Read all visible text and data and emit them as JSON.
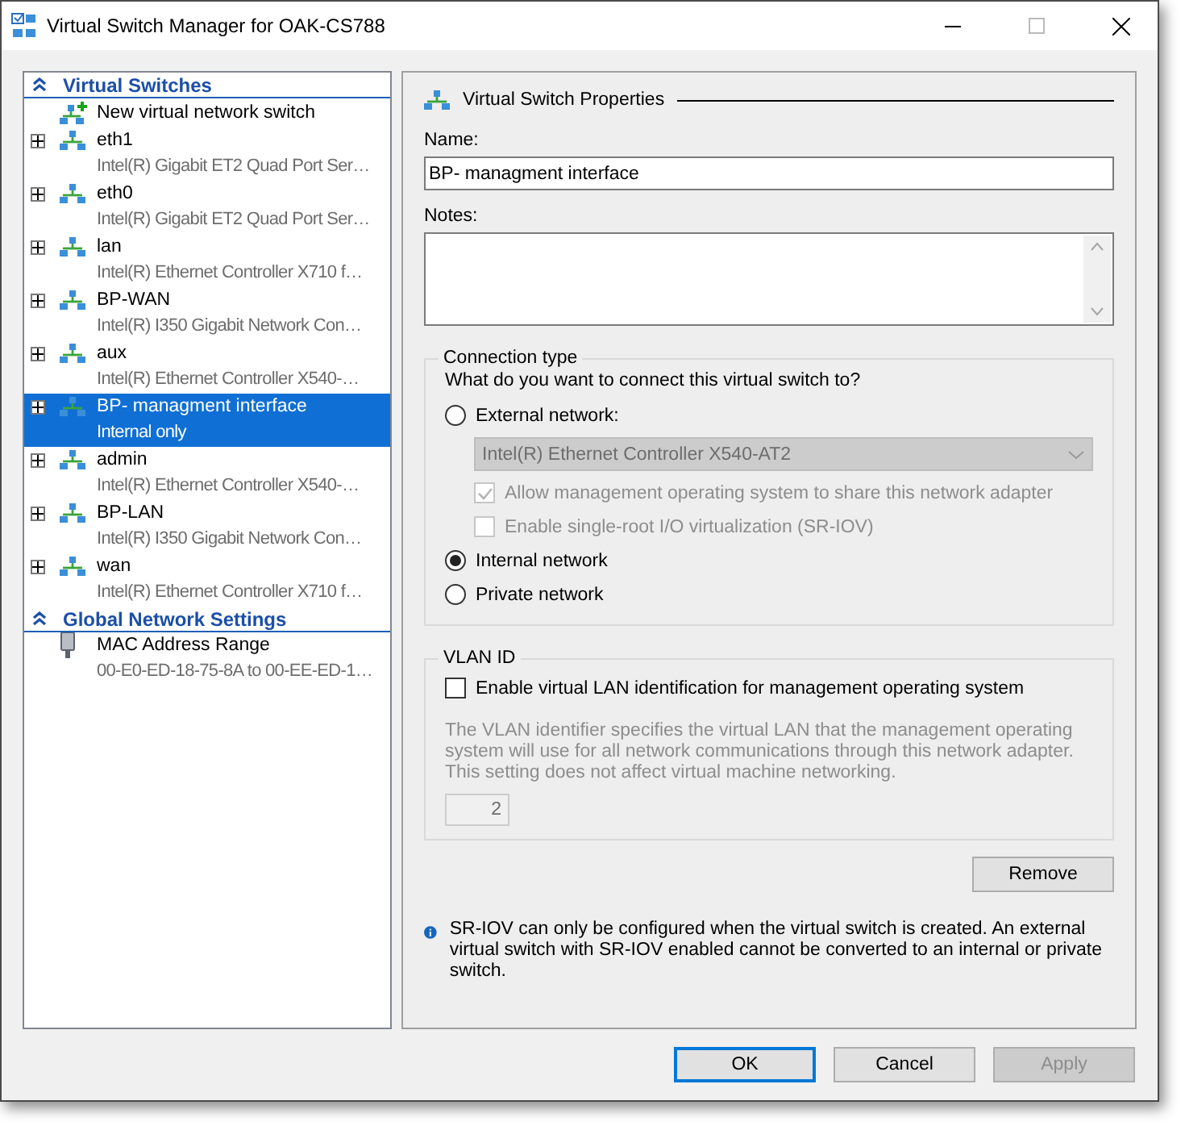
{
  "window": {
    "title": "Virtual Switch Manager for OAK-CS788"
  },
  "sidebar": {
    "sections": [
      {
        "title": "Virtual Switches",
        "expanded": true,
        "items": [
          {
            "kind": "new",
            "name": "New virtual network switch",
            "selected": false
          },
          {
            "kind": "switch",
            "name": "eth1",
            "detail": "Intel(R) Gigabit ET2 Quad Port Ser…",
            "selected": false
          },
          {
            "kind": "switch",
            "name": "eth0",
            "detail": "Intel(R) Gigabit ET2 Quad Port Ser…",
            "selected": false
          },
          {
            "kind": "switch",
            "name": "lan",
            "detail": "Intel(R) Ethernet Controller X710 f…",
            "selected": false
          },
          {
            "kind": "switch",
            "name": "BP-WAN",
            "detail": "Intel(R) I350 Gigabit Network Con…",
            "selected": false
          },
          {
            "kind": "switch",
            "name": "aux",
            "detail": "Intel(R) Ethernet Controller X540-…",
            "selected": false
          },
          {
            "kind": "switch",
            "name": "BP- managment interface",
            "detail": "Internal only",
            "selected": true
          },
          {
            "kind": "switch",
            "name": "admin",
            "detail": "Intel(R) Ethernet Controller X540-…",
            "selected": false
          },
          {
            "kind": "switch",
            "name": "BP-LAN",
            "detail": "Intel(R) I350 Gigabit Network Con…",
            "selected": false
          },
          {
            "kind": "switch",
            "name": "wan",
            "detail": "Intel(R) Ethernet Controller X710 f…",
            "selected": false
          }
        ]
      },
      {
        "title": "Global Network Settings",
        "expanded": true,
        "items": [
          {
            "kind": "setting",
            "name": "MAC Address Range",
            "detail": "00-E0-ED-18-75-8A to 00-EE-ED-1…",
            "selected": false
          }
        ]
      }
    ]
  },
  "properties": {
    "heading": "Virtual Switch Properties",
    "name_label": "Name:",
    "name_value": "BP- managment interface",
    "notes_label": "Notes:",
    "connection": {
      "legend": "Connection type",
      "question": "What do you want to connect this virtual switch to?",
      "options": [
        {
          "label": "External network:",
          "selected": false,
          "adapter": {
            "value": "Intel(R) Ethernet Controller X540-AT2",
            "disabled": true
          },
          "checkboxes": [
            {
              "label": "Allow management operating system to share this network adapter",
              "checked": true,
              "disabled": true
            },
            {
              "label": "Enable single-root I/O virtualization (SR-IOV)",
              "checked": false,
              "disabled": true
            }
          ]
        },
        {
          "label": "Internal network",
          "selected": true
        },
        {
          "label": "Private network",
          "selected": false
        }
      ]
    },
    "vlan": {
      "legend": "VLAN ID",
      "checkbox": {
        "label": "Enable virtual LAN identification for management operating system",
        "checked": false
      },
      "description": "The VLAN identifier specifies the virtual LAN that the management operating system will use for all network communications through this network adapter. This setting does not affect virtual machine networking.",
      "value": "2",
      "disabled": true
    },
    "remove_button": "Remove",
    "info": "SR-IOV can only be configured when the virtual switch is created. An external virtual switch with SR-IOV enabled cannot be converted to an internal or private switch."
  },
  "buttons": [
    {
      "label": "OK",
      "default": true,
      "disabled": false
    },
    {
      "label": "Cancel",
      "default": false,
      "disabled": false
    },
    {
      "label": "Apply",
      "default": false,
      "disabled": true
    }
  ]
}
